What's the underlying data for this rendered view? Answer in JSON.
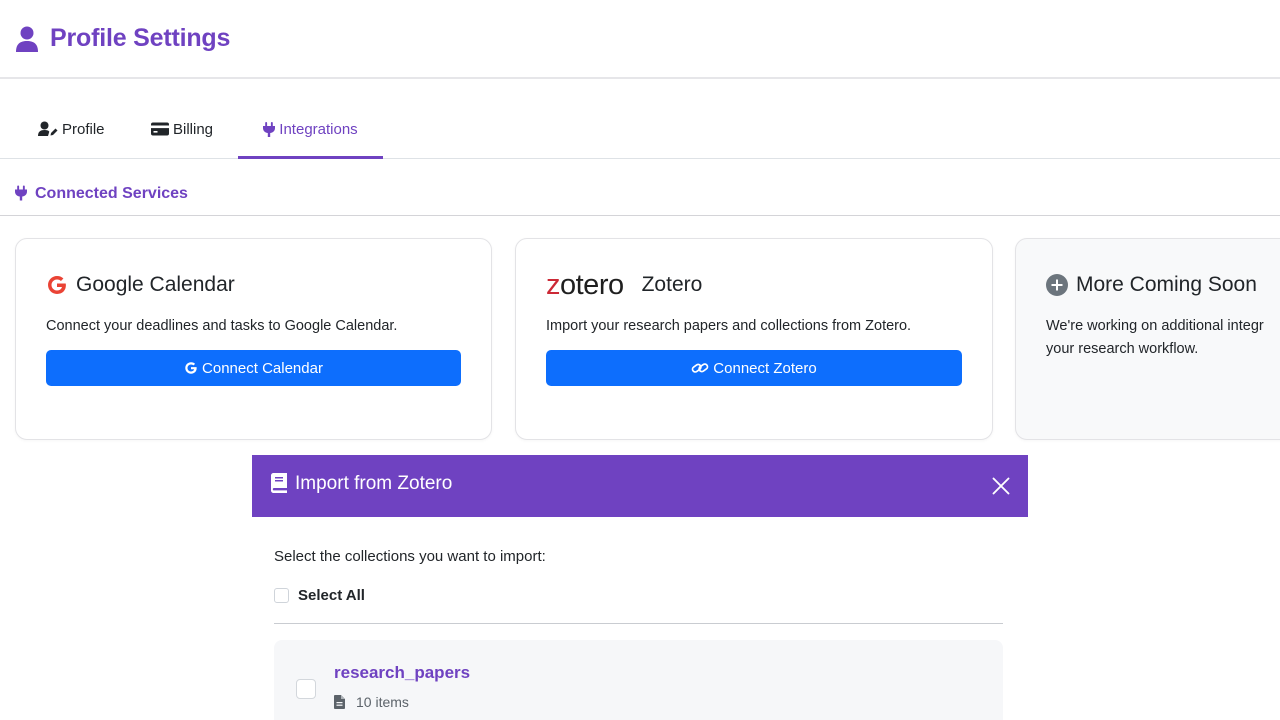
{
  "header": {
    "title": "Profile Settings",
    "icon": "user-icon"
  },
  "tabs": [
    {
      "label": "Profile",
      "icon": "user-pen-icon",
      "active": false
    },
    {
      "label": "Billing",
      "icon": "credit-card-icon",
      "active": false
    },
    {
      "label": "Integrations",
      "icon": "plug-icon",
      "active": true
    }
  ],
  "section": {
    "title": "Connected Services",
    "icon": "plug-icon"
  },
  "cards": {
    "google": {
      "title": "Google Calendar",
      "description": "Connect your deadlines and tasks to Google Calendar.",
      "button": "Connect Calendar",
      "icon": "google-icon"
    },
    "zotero": {
      "logo": "zotero",
      "title": "Zotero",
      "description": "Import your research papers and collections from Zotero.",
      "button": "Connect Zotero",
      "button_icon": "link-icon"
    },
    "more": {
      "title": "More Coming Soon",
      "description_line1": "We're working on additional integr",
      "description_line2": "your research workflow.",
      "icon": "plus-circle-icon"
    }
  },
  "modal": {
    "title": "Import from Zotero",
    "icon": "book-icon",
    "prompt": "Select the collections you want to import:",
    "select_all": "Select All",
    "collections": [
      {
        "name": "research_papers",
        "count": "10 items",
        "checked": false
      }
    ]
  },
  "colors": {
    "accent": "#6f42c1",
    "primary": "#0d6efd",
    "google_red": "#ea4335",
    "zotero_red": "#cc2936"
  }
}
